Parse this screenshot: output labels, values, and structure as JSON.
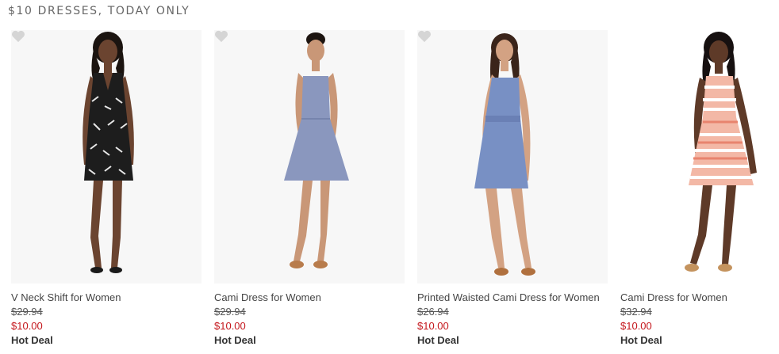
{
  "section": {
    "title": "$10 DRESSES, TODAY ONLY"
  },
  "products": [
    {
      "name": "V Neck Shift for Women",
      "original_price": "$29.94",
      "sale_price": "$10.00",
      "badge": "Hot Deal"
    },
    {
      "name": "Cami Dress for Women",
      "original_price": "$29.94",
      "sale_price": "$10.00",
      "badge": "Hot Deal"
    },
    {
      "name": "Printed Waisted Cami Dress for Women",
      "original_price": "$26.94",
      "sale_price": "$10.00",
      "badge": "Hot Deal"
    },
    {
      "name": "Cami Dress for Women",
      "original_price": "$32.94",
      "sale_price": "$10.00",
      "badge": "Hot Deal"
    }
  ],
  "colors": {
    "sale_price": "#c4161c",
    "heart_icon": "#d5d5d5",
    "photo_background": "#f7f7f7"
  },
  "icons": {
    "favorite": "heart-icon"
  }
}
